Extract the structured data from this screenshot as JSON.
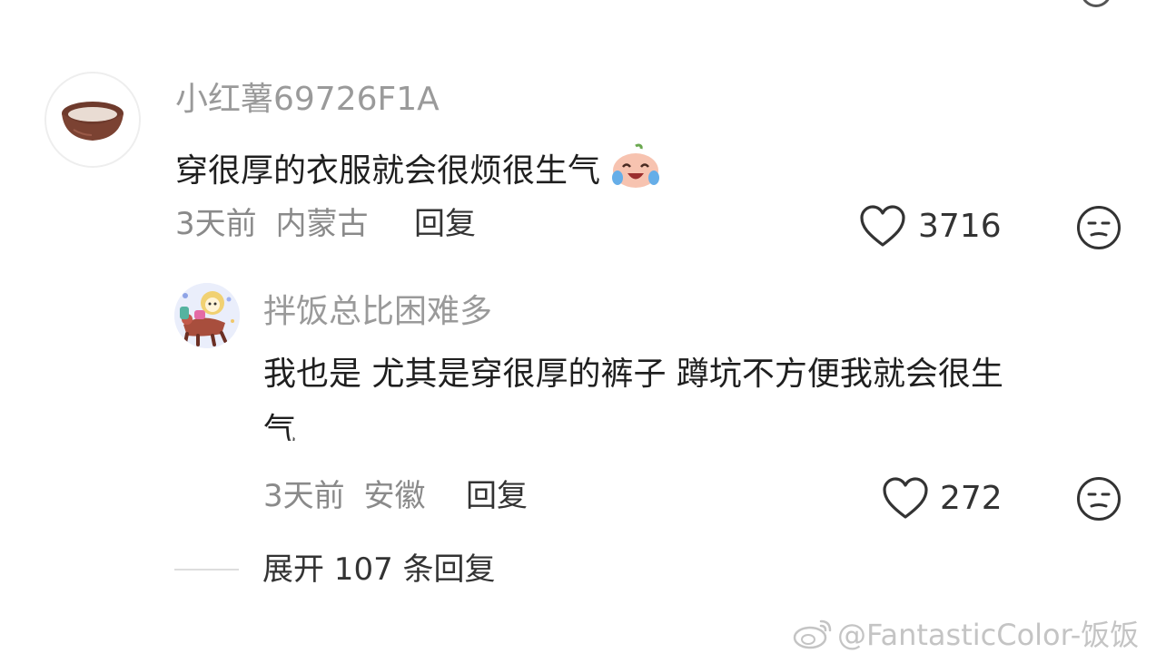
{
  "comment": {
    "username": "小红薯69726F1A",
    "text": "穿很厚的衣服就会很烦很生气",
    "time": "3天前",
    "location": "内蒙古",
    "reply_label": "回复",
    "likes": "3716",
    "emoji_icon": "crying-laughing-emoji-icon",
    "avatar_icon": "coconut-bowl-avatar"
  },
  "reply": {
    "username": "拌饭总比困难多",
    "text_line1": "我也是 尤其是穿很厚的裤子 蹲坑不方便我就会很生",
    "text_line2": "气",
    "time": "3天前",
    "location": "安徽",
    "reply_label": "回复",
    "likes": "272",
    "avatar_icon": "cartoon-lion-avatar"
  },
  "expand_label": "展开 107 条回复",
  "watermark": "@FantasticColor-饭饭",
  "colors": {
    "username": "#9a9a9a",
    "meta": "#8a8a8a",
    "text": "#1f1f1f",
    "watermark": "#c4c4c4"
  }
}
